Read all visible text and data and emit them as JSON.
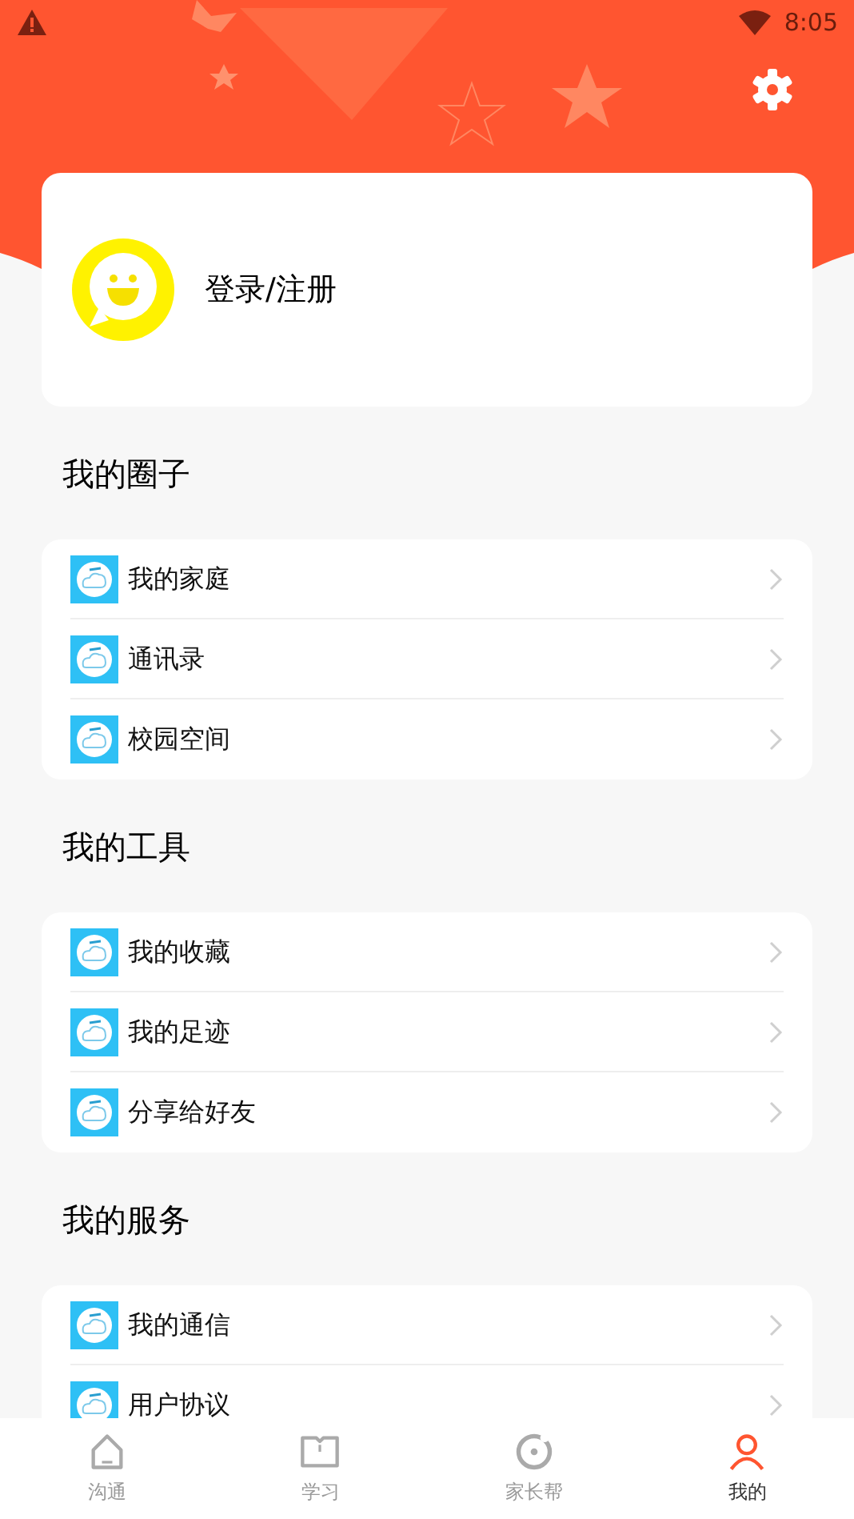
{
  "status_bar": {
    "time": "8:05"
  },
  "profile": {
    "login_label": "登录/注册"
  },
  "sections": [
    {
      "title": "我的圈子",
      "items": [
        {
          "label": "我的家庭"
        },
        {
          "label": "通讯录"
        },
        {
          "label": "校园空间"
        }
      ]
    },
    {
      "title": "我的工具",
      "items": [
        {
          "label": "我的收藏"
        },
        {
          "label": "我的足迹"
        },
        {
          "label": "分享给好友"
        }
      ]
    },
    {
      "title": "我的服务",
      "items": [
        {
          "label": "我的通信"
        },
        {
          "label": "用户协议"
        }
      ]
    }
  ],
  "bottom_nav": [
    {
      "label": "沟通",
      "kind": "home",
      "selected": false
    },
    {
      "label": "学习",
      "kind": "book",
      "selected": false
    },
    {
      "label": "家长帮",
      "kind": "ring",
      "selected": false
    },
    {
      "label": "我的",
      "kind": "person",
      "selected": true
    }
  ]
}
